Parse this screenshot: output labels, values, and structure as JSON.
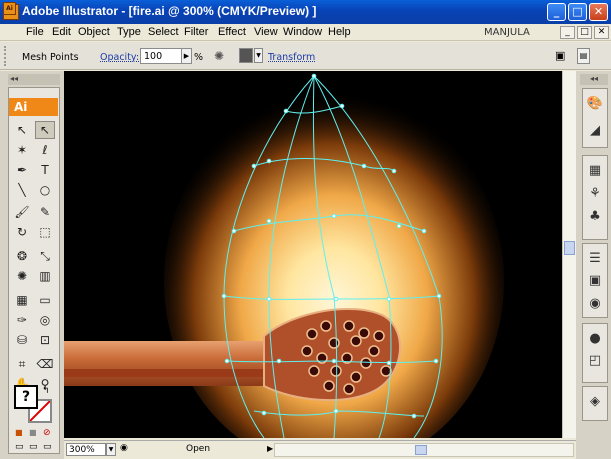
{
  "window": {
    "title": "Adobe Illustrator - [fire.ai @ 300% (CMYK/Preview) ]",
    "app_icon": "Ai",
    "minimize": "_",
    "maximize": "□",
    "close": "✕",
    "colors": {
      "titlebar": "#0842b5",
      "accent": "#f08818"
    }
  },
  "menubar": {
    "items": [
      "File",
      "Edit",
      "Object",
      "Type",
      "Select",
      "Filter",
      "Effect",
      "View",
      "Window",
      "Help"
    ],
    "user": "MANJULA",
    "doc_controls": [
      "_",
      "□",
      "✕"
    ]
  },
  "controlbar": {
    "selection_label": "Mesh Points",
    "opacity_label": "Opacity:",
    "opacity_value": "100",
    "opacity_unit": "%",
    "transform_label": "Transform"
  },
  "toolbox": {
    "header": "◂◂",
    "badge": "Ai",
    "tools": [
      {
        "name": "selection-arrow-icon",
        "glyph": "↖"
      },
      {
        "name": "direct-selection-icon",
        "glyph": "↖",
        "selected": true
      },
      {
        "name": "magic-wand-icon",
        "glyph": "✶"
      },
      {
        "name": "lasso-icon",
        "glyph": "ℓ"
      },
      {
        "name": "pen-icon",
        "glyph": "✒"
      },
      {
        "name": "type-icon",
        "glyph": "T"
      },
      {
        "name": "line-segment-icon",
        "glyph": "╲"
      },
      {
        "name": "ellipse-icon",
        "glyph": "○"
      },
      {
        "name": "paintbrush-icon",
        "glyph": "🖌"
      },
      {
        "name": "pencil-icon",
        "glyph": "✎"
      },
      {
        "name": "rotate-icon",
        "glyph": "↻"
      },
      {
        "name": "scale-icon",
        "glyph": "⬚"
      },
      {
        "name": "warp-icon",
        "glyph": "❂"
      },
      {
        "name": "free-transform-icon",
        "glyph": "⤡"
      },
      {
        "name": "symbol-sprayer-icon",
        "glyph": "✺"
      },
      {
        "name": "column-graph-icon",
        "glyph": "▥"
      },
      {
        "name": "mesh-icon",
        "glyph": "▦"
      },
      {
        "name": "gradient-icon",
        "glyph": "▭"
      },
      {
        "name": "eyedropper-icon",
        "glyph": "✑"
      },
      {
        "name": "blend-icon",
        "glyph": "◎"
      },
      {
        "name": "live-paint-bucket-icon",
        "glyph": "⛁"
      },
      {
        "name": "live-paint-selection-icon",
        "glyph": "⊡"
      },
      {
        "name": "crop-icon",
        "glyph": "⌗"
      },
      {
        "name": "eraser-icon",
        "glyph": "⌫"
      },
      {
        "name": "hand-icon",
        "glyph": "✋"
      },
      {
        "name": "zoom-icon",
        "glyph": "⚲"
      }
    ],
    "fill_glyph": "?",
    "modes": [
      "■",
      "■",
      "⊘"
    ],
    "screen_modes": [
      "▭",
      "▭",
      "▭"
    ]
  },
  "status": {
    "zoom": "300%",
    "text": "Open"
  },
  "rightpanel": {
    "header": "◂◂",
    "icons": [
      {
        "name": "color-palette-icon",
        "glyph": "🎨"
      },
      {
        "name": "gradient-panel-icon",
        "glyph": "◢"
      },
      {
        "name": "swatches-icon",
        "glyph": "▦"
      },
      {
        "name": "brushes-icon",
        "glyph": "⚘"
      },
      {
        "name": "symbols-icon",
        "glyph": "♣"
      },
      {
        "name": "stroke-icon",
        "glyph": "☰"
      },
      {
        "name": "transparency-icon",
        "glyph": "▣"
      },
      {
        "name": "appearance-icon",
        "glyph": "◉"
      },
      {
        "name": "graphic-styles-icon",
        "glyph": "●"
      },
      {
        "name": "layers-icon",
        "glyph": "◰"
      },
      {
        "name": "navigator-icon",
        "glyph": "◈"
      }
    ]
  }
}
